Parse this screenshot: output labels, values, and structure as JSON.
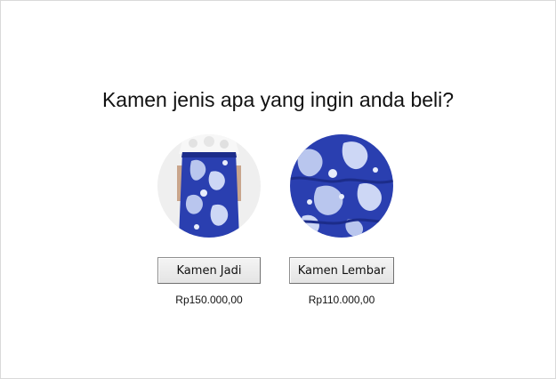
{
  "question": "Kamen jenis apa yang ingin anda beli?",
  "options": [
    {
      "button_label": "Kamen Jadi",
      "price": "Rp150.000,00",
      "image": "batik-skirt-worn-photo"
    },
    {
      "button_label": "Kamen Lembar",
      "price": "Rp110.000,00",
      "image": "batik-fabric-sheet-photo"
    }
  ],
  "colors": {
    "batik_blue": "#2a3fb0",
    "batik_light": "#b9c6ee",
    "background": "#ffffff"
  }
}
